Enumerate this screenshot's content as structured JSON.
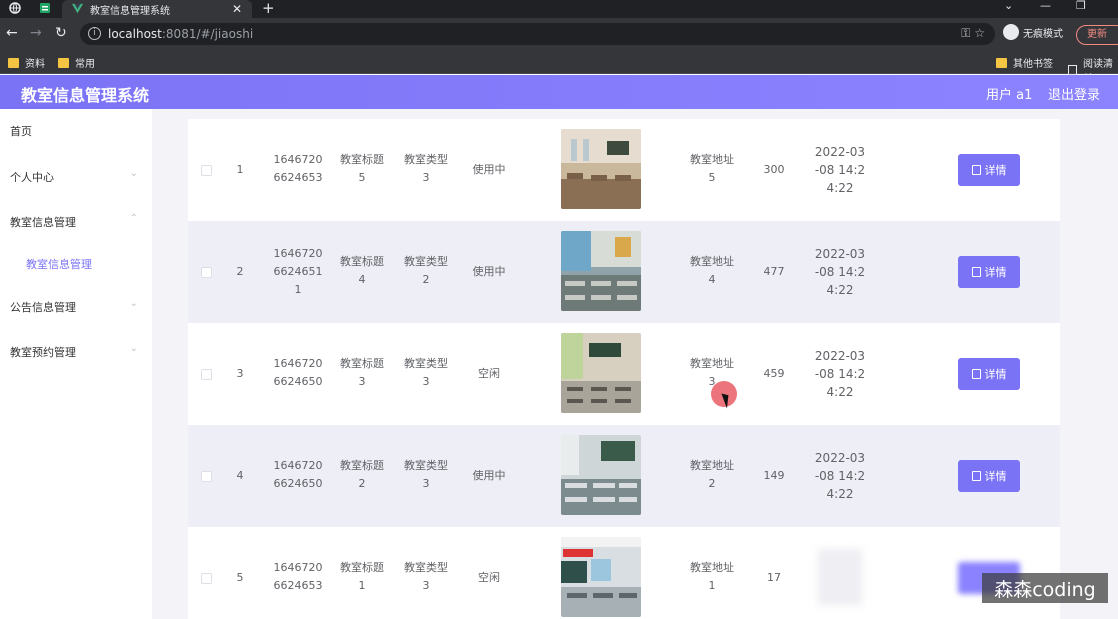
{
  "browser": {
    "tab_title": "教室信息管理系统",
    "url_host": "localhost",
    "url_rest": ":8081/#/jiaoshi",
    "profile_label": "无痕模式",
    "update_label": "更新",
    "bookmarks": [
      "资料",
      "常用"
    ],
    "bookmarks_right": [
      "其他书签",
      "阅读清单"
    ]
  },
  "header": {
    "title": "教室信息管理系统",
    "user": "用户 a1",
    "logout": "退出登录"
  },
  "sidebar": {
    "items": [
      {
        "label": "首页"
      },
      {
        "label": "个人中心"
      },
      {
        "label": "教室信息管理"
      },
      {
        "label": "教室信息管理",
        "sub": true
      },
      {
        "label": "公告信息管理"
      },
      {
        "label": "教室预约管理"
      }
    ]
  },
  "table": {
    "rows": [
      {
        "index": "1",
        "id_line1": "1646720",
        "id_line2": "6624653",
        "id_line3": "",
        "title_l1": "教室标题",
        "title_l2": "5",
        "type_l1": "教室类型",
        "type_l2": "3",
        "status": "使用中",
        "addr_l1": "教室地址",
        "addr_l2": "5",
        "capacity": "300",
        "time_l1": "2022-03",
        "time_l2": "-08 14:2",
        "time_l3": "4:22",
        "btn": "详情"
      },
      {
        "index": "2",
        "id_line1": "1646720",
        "id_line2": "6624651",
        "id_line3": "1",
        "title_l1": "教室标题",
        "title_l2": "4",
        "type_l1": "教室类型",
        "type_l2": "2",
        "status": "使用中",
        "addr_l1": "教室地址",
        "addr_l2": "4",
        "capacity": "477",
        "time_l1": "2022-03",
        "time_l2": "-08 14:2",
        "time_l3": "4:22",
        "btn": "详情"
      },
      {
        "index": "3",
        "id_line1": "1646720",
        "id_line2": "6624650",
        "id_line3": "",
        "title_l1": "教室标题",
        "title_l2": "3",
        "type_l1": "教室类型",
        "type_l2": "3",
        "status": "空闲",
        "addr_l1": "教室地址",
        "addr_l2": "3",
        "capacity": "459",
        "time_l1": "2022-03",
        "time_l2": "-08 14:2",
        "time_l3": "4:22",
        "btn": "详情"
      },
      {
        "index": "4",
        "id_line1": "1646720",
        "id_line2": "6624650",
        "id_line3": "",
        "title_l1": "教室标题",
        "title_l2": "2",
        "type_l1": "教室类型",
        "type_l2": "3",
        "status": "使用中",
        "addr_l1": "教室地址",
        "addr_l2": "2",
        "capacity": "149",
        "time_l1": "2022-03",
        "time_l2": "-08 14:2",
        "time_l3": "4:22",
        "btn": "详情"
      },
      {
        "index": "5",
        "id_line1": "1646720",
        "id_line2": "6624653",
        "id_line3": "",
        "title_l1": "教室标题",
        "title_l2": "1",
        "type_l1": "教室类型",
        "type_l2": "3",
        "status": "空闲",
        "addr_l1": "教室地址",
        "addr_l2": "1",
        "capacity": "17",
        "time_l1": "",
        "time_l2": "",
        "time_l3": "",
        "btn": ""
      }
    ]
  },
  "watermark": "森森coding",
  "colors": {
    "accent": "#7b73f5",
    "row_alt": "#eeeef6"
  }
}
